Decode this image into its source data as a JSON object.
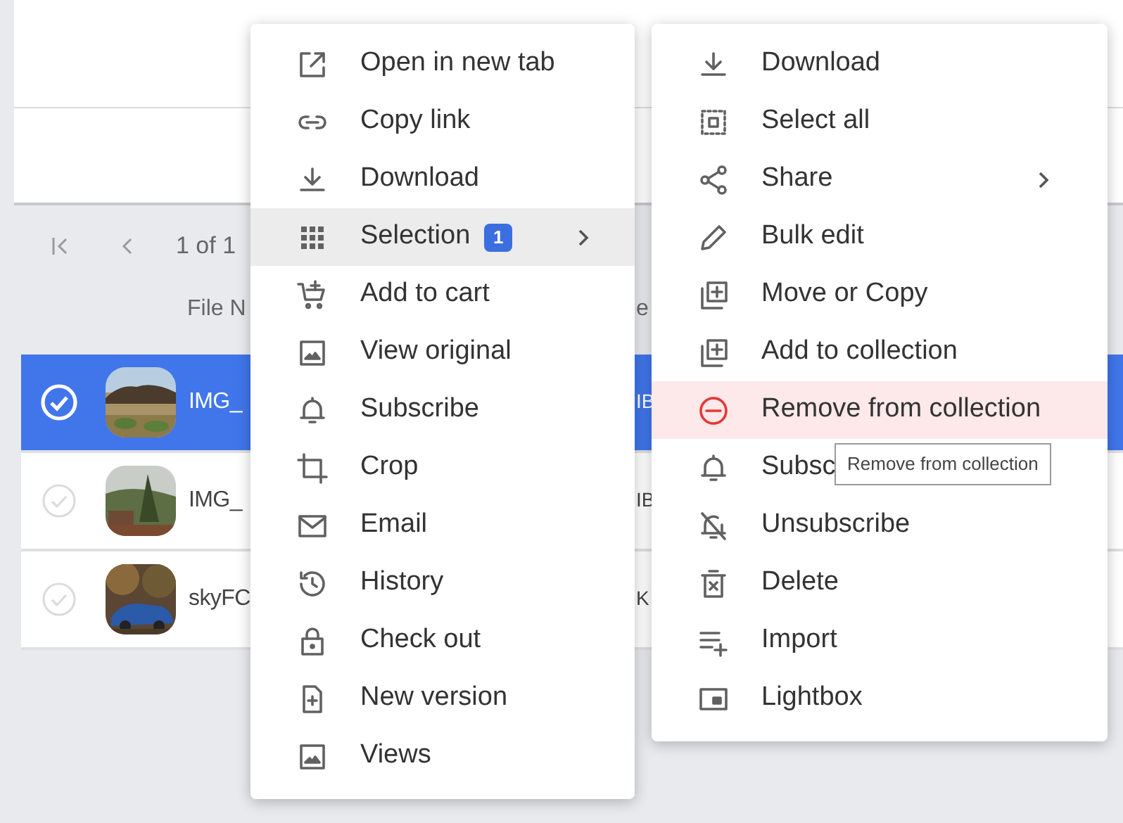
{
  "table": {
    "pagination": {
      "label": "1 of 1"
    },
    "columns": [
      {
        "label": "File N"
      },
      {
        "label": "e"
      }
    ],
    "rows": [
      {
        "selected": true,
        "name": "IMG_",
        "column_2": "IB"
      },
      {
        "selected": false,
        "name": "IMG_",
        "column_2": "IB"
      },
      {
        "selected": false,
        "name": "skyFC",
        "column_2": "K"
      }
    ]
  },
  "context_menu": {
    "items": [
      {
        "label": "Open in new tab",
        "highlighted": false,
        "submenu": false
      },
      {
        "label": "Copy link",
        "highlighted": false,
        "submenu": false
      },
      {
        "label": "Download",
        "highlighted": false,
        "submenu": false
      },
      {
        "label": "Selection",
        "highlighted": true,
        "submenu": true,
        "badge": "1"
      },
      {
        "label": "Add to cart",
        "highlighted": false,
        "submenu": false
      },
      {
        "label": "View original",
        "highlighted": false,
        "submenu": false
      },
      {
        "label": "Subscribe",
        "highlighted": false,
        "submenu": false
      },
      {
        "label": "Crop",
        "highlighted": false,
        "submenu": false
      },
      {
        "label": "Email",
        "highlighted": false,
        "submenu": false
      },
      {
        "label": "History",
        "highlighted": false,
        "submenu": false
      },
      {
        "label": "Check out",
        "highlighted": false,
        "submenu": false
      },
      {
        "label": "New version",
        "highlighted": false,
        "submenu": false
      },
      {
        "label": "Views",
        "highlighted": false,
        "submenu": false
      }
    ]
  },
  "submenu": {
    "items": [
      {
        "label": "Download",
        "highlighted": false,
        "submenu": false
      },
      {
        "label": "Select all",
        "highlighted": false,
        "submenu": false
      },
      {
        "label": "Share",
        "highlighted": false,
        "submenu": true
      },
      {
        "label": "Bulk edit",
        "highlighted": false,
        "submenu": false
      },
      {
        "label": "Move or Copy",
        "highlighted": false,
        "submenu": false
      },
      {
        "label": "Add to collection",
        "highlighted": false,
        "submenu": false
      },
      {
        "label": "Remove from collection",
        "highlighted": true,
        "submenu": false
      },
      {
        "label": "Subsc",
        "highlighted": false,
        "submenu": false
      },
      {
        "label": "Unsubscribe",
        "highlighted": false,
        "submenu": false
      },
      {
        "label": "Delete",
        "highlighted": false,
        "submenu": false
      },
      {
        "label": "Import",
        "highlighted": false,
        "submenu": false
      },
      {
        "label": "Lightbox",
        "highlighted": false,
        "submenu": false
      }
    ]
  },
  "tooltip": {
    "text": "Remove from collection"
  }
}
